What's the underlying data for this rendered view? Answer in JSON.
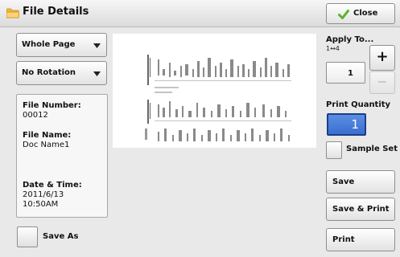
{
  "header": {
    "title": "File Details",
    "close_label": "Close"
  },
  "left": {
    "page_dropdown": "Whole Page",
    "rotation_dropdown": "No Rotation",
    "info": {
      "file_number_label": "File Number:",
      "file_number_value": "00012",
      "file_name_label": "File Name:",
      "file_name_value": "Doc Name1",
      "datetime_label": "Date & Time:",
      "date_value": "2011/6/13",
      "time_value": "10:50AM"
    },
    "save_as_label": "Save As"
  },
  "right": {
    "apply_to_label": "Apply To...",
    "apply_to_range": "1↔4",
    "apply_to_value": "1",
    "plus_label": "+",
    "minus_label": "−",
    "print_quantity_label": "Print Quantity",
    "print_quantity_value": "1",
    "sample_set_label": "Sample Set",
    "save_label": "Save",
    "save_print_label": "Save & Print",
    "print_label": "Print"
  },
  "icons": {
    "folder": "folder-icon",
    "check": "check-icon",
    "arrow": "chevron-down-icon"
  },
  "colors": {
    "accent": "#4a80db",
    "folder": "#f2b43a",
    "check": "#59b02a"
  }
}
